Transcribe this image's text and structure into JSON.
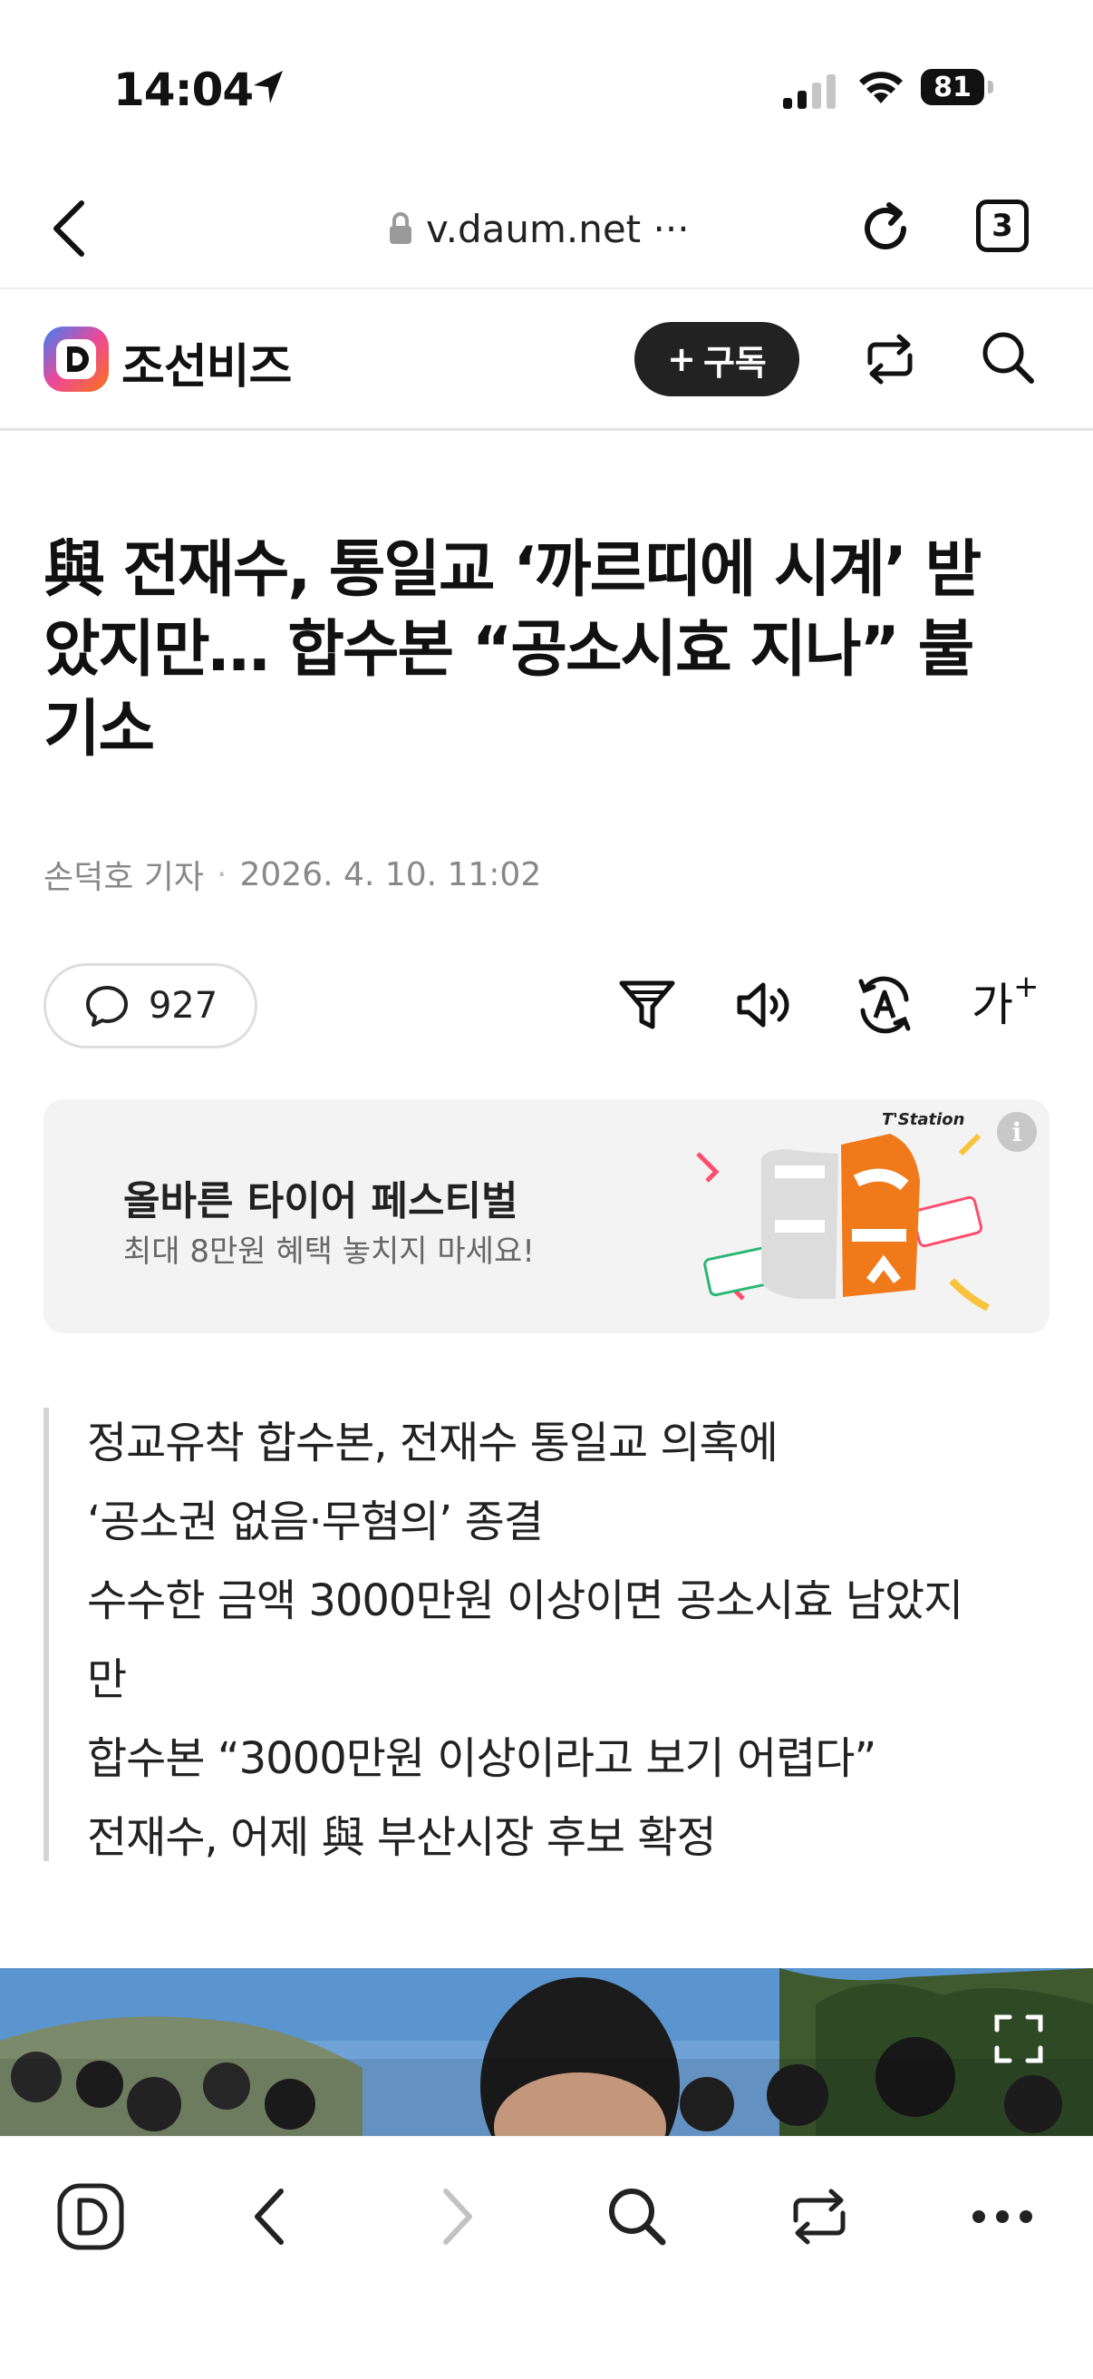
{
  "status_bar": {
    "time": "14:04",
    "battery": "81"
  },
  "browser": {
    "url": "v.daum.net ···",
    "tab_count": "3"
  },
  "site": {
    "name": "조선비즈",
    "logo_letter": "D",
    "subscribe_label": "구독",
    "subscribe_plus": "+"
  },
  "article": {
    "headline_lines": [
      "與 전재수, 통일교 ‘까르띠에 시계’ 받",
      "았지만… 합수본 “공소시효 지나” 불",
      "기소"
    ],
    "author": "손덕호 기자",
    "separator": "·",
    "date": "2026. 4. 10. 11:02",
    "comment_count": "927",
    "font_tool_label": "가",
    "font_tool_plus": "+",
    "summary_lines": [
      "정교유착 합수본, 전재수 통일교 의혹에",
      "‘공소권 없음·무혐의’ 종결",
      "수수한 금액 3000만원 이상이면 공소시효 남았지",
      "만",
      "합수본 “3000만원 이상이라고 보기 어렵다”",
      "전재수, 어제 與 부산시장 후보 확정"
    ]
  },
  "ad": {
    "title": "올바른 타이어 페스티벌",
    "subtitle": "최대 8만원 혜택 놓치지 마세요!",
    "brand": "T'Station",
    "info_label": "i"
  },
  "colors": {
    "accent_orange": "#f07a1a",
    "dark_button": "#222222",
    "logo_gradient": [
      "#3b82f6",
      "#f97316",
      "#ec4899"
    ]
  },
  "icons": [
    "back-icon",
    "lock-icon",
    "reload-icon",
    "share-icon",
    "search-icon",
    "comment-icon",
    "filter-icon",
    "audio-icon",
    "translate-icon",
    "expand-icon",
    "daum-icon",
    "forward-icon",
    "more-icon"
  ]
}
